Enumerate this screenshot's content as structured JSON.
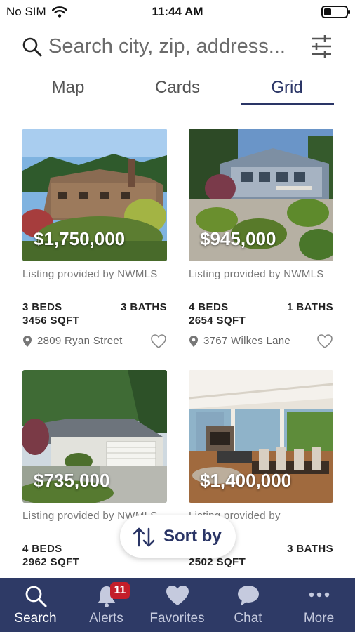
{
  "status_bar": {
    "carrier": "No SIM",
    "time": "11:44 AM"
  },
  "search": {
    "placeholder": "Search city, zip, address..."
  },
  "tabs": [
    {
      "label": "Map",
      "active": false
    },
    {
      "label": "Cards",
      "active": false
    },
    {
      "label": "Grid",
      "active": true
    }
  ],
  "listings": [
    {
      "price": "$1,750,000",
      "provided_by": "Listing provided by NWMLS",
      "beds": "3 BEDS",
      "baths": "3 BATHS",
      "sqft": "3456 SQFT",
      "address": "2809 Ryan Street"
    },
    {
      "price": "$945,000",
      "provided_by": "Listing provided by NWMLS",
      "beds": "4 BEDS",
      "baths": "1 BATHS",
      "sqft": "2654 SQFT",
      "address": "3767 Wilkes Lane"
    },
    {
      "price": "$735,000",
      "provided_by": "Listing provided by NWMLS",
      "beds": "4 BEDS",
      "baths": "",
      "sqft": "2962 SQFT",
      "address": ""
    },
    {
      "price": "$1,400,000",
      "provided_by": "Listing provided by",
      "beds": "",
      "baths": "3 BATHS",
      "sqft": "2502 SQFT",
      "address": ""
    }
  ],
  "sort": {
    "label": "Sort by"
  },
  "bottom_nav": [
    {
      "label": "Search",
      "icon": "search-icon",
      "active": true
    },
    {
      "label": "Alerts",
      "icon": "bell-icon",
      "badge": "11"
    },
    {
      "label": "Favorites",
      "icon": "heart-icon"
    },
    {
      "label": "Chat",
      "icon": "chat-icon"
    },
    {
      "label": "More",
      "icon": "more-icon"
    }
  ],
  "colors": {
    "brand_navy": "#2e3a66",
    "active_tab": "#2a3566",
    "badge_red": "#c41e2a"
  }
}
